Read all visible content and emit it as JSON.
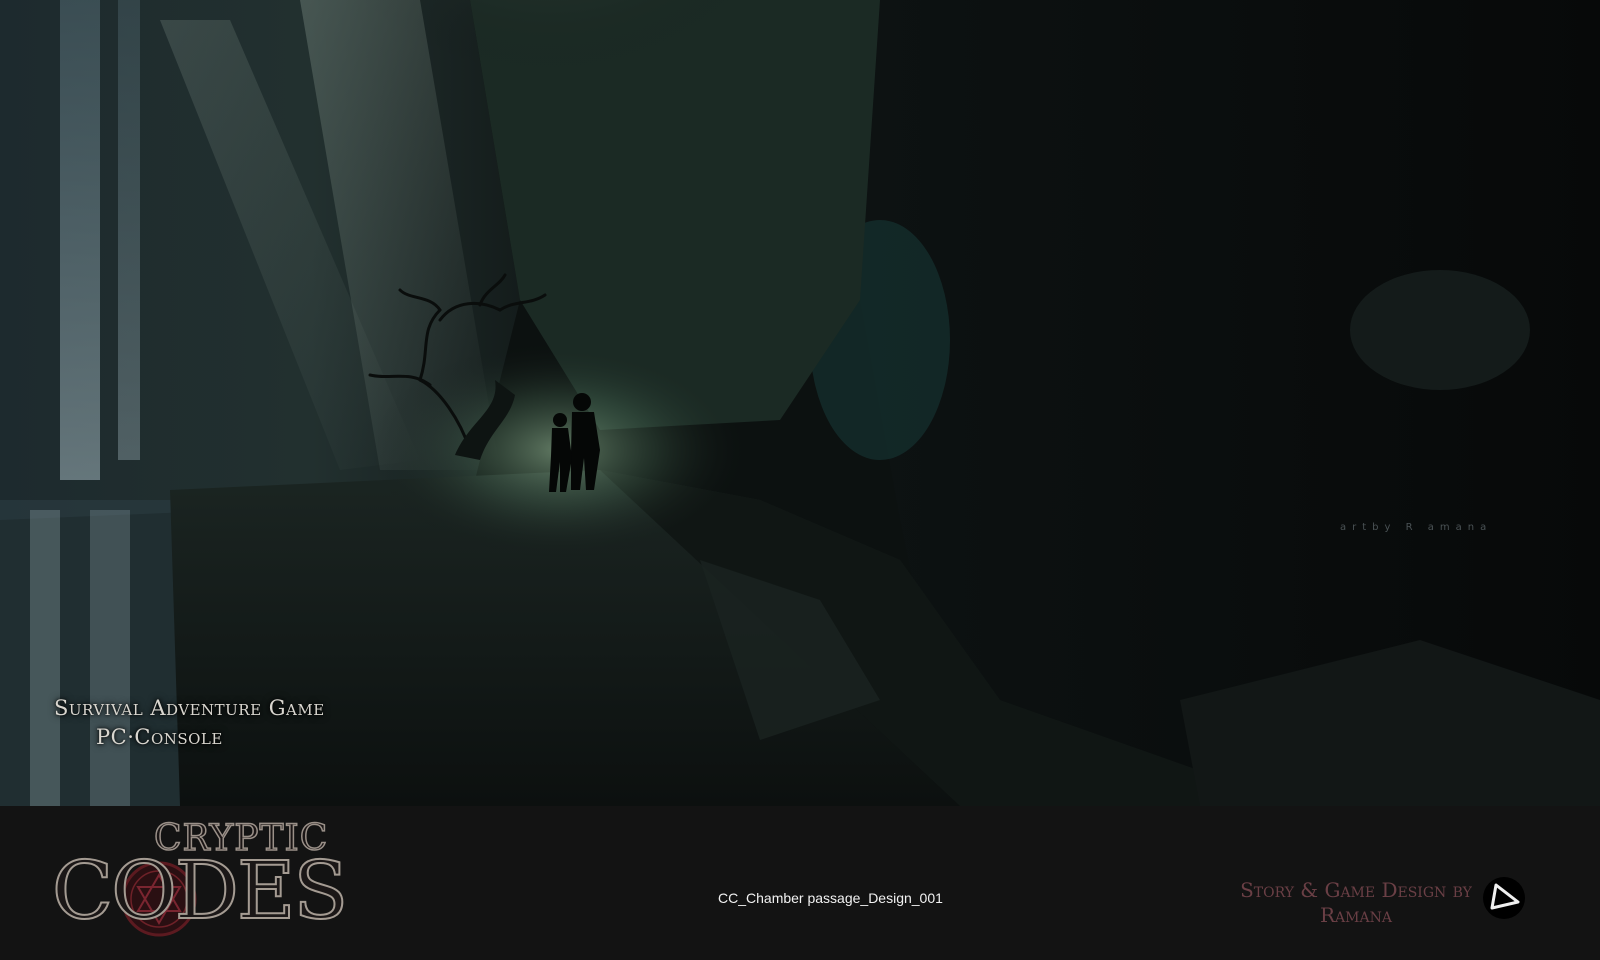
{
  "scene": {
    "tagline_genre": "Survival Adventure Game",
    "tagline_platform": "PC·Console",
    "artist_watermark": "artby R amana"
  },
  "caption_bar": {
    "logo_top_word": "CRYPTIC",
    "logo_main_word": "CODES",
    "file_caption": "CC_Chamber passage_Design_001",
    "credit_line_1": "Story & Game Design by",
    "credit_line_2": "Ramana"
  },
  "colors": {
    "caption_background": "#131313",
    "credit_text": "#6a3f45",
    "tagline_text": "#d9d6cf",
    "scene_glow": "#9fc7a4"
  },
  "icons": {
    "logo_seal": "hexagram-seal-icon",
    "studio_mark": "triangle-logo-icon"
  }
}
